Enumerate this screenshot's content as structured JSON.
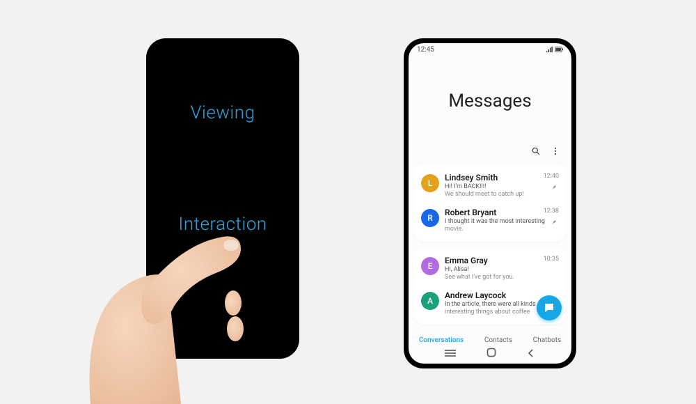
{
  "left_phone": {
    "viewing_label": "Viewing",
    "interaction_label": "Interaction"
  },
  "status_bar": {
    "time": "12:45"
  },
  "header": {
    "title": "Messages"
  },
  "tabs": {
    "conversations": "Conversations",
    "contacts": "Contacts",
    "chatbots": "Chatbots"
  },
  "conversations_pinned": [
    {
      "name": "Lindsey Smith",
      "line1": "Hi! I'm BACK!!!!",
      "line2": "We should meet to catch up!",
      "time": "12:40",
      "avatar_letter": "L",
      "avatar_color": "#e6a11c",
      "pinned": true
    },
    {
      "name": "Robert Bryant",
      "line1": "I thought it was the most interesting",
      "line2": "movie.",
      "time": "12:38",
      "avatar_letter": "R",
      "avatar_color": "#1767e6",
      "pinned": true
    }
  ],
  "conversations": [
    {
      "name": "Emma Gray",
      "line1": "Hi, Alisa!",
      "line2": "See what I've got for you.",
      "time": "10:35",
      "avatar_letter": "E",
      "avatar_color": "#b06be0"
    },
    {
      "name": "Andrew Laycock",
      "line1": "In the article, there were all kinds of",
      "line2": "interesting things about coffee",
      "time": "",
      "avatar_letter": "A",
      "avatar_color": "#1aa07a"
    }
  ]
}
